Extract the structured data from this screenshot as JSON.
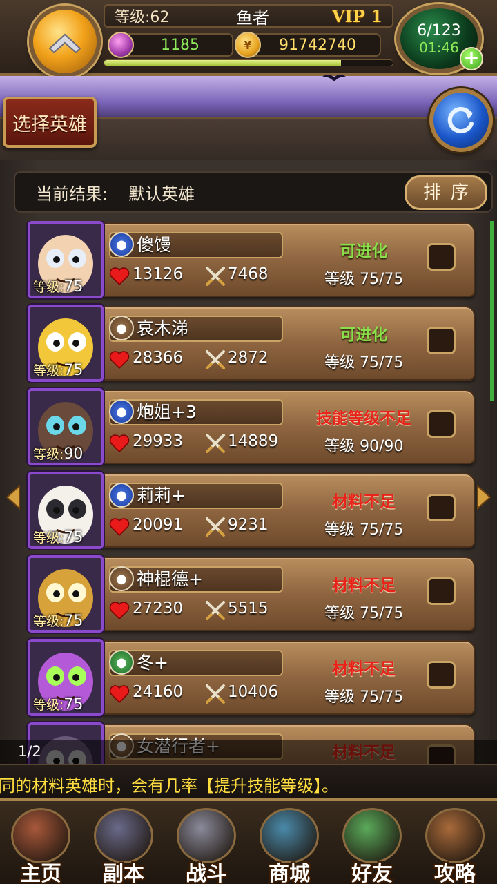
{
  "top_bar": {
    "level_label": "等级:62",
    "player_name": "鱼者",
    "vip_label": "VIP 1",
    "gems": "1185",
    "gold": "91742740",
    "exp_fraction": 0.82,
    "stamina": "6/123",
    "stamina_timer": "01:46",
    "plus_label": "+"
  },
  "header": {
    "select_hero_label": "选择英雄"
  },
  "result_bar": {
    "label": "当前结果:",
    "value": "默认英雄",
    "sort_label": "排序"
  },
  "heroes": [
    {
      "name": "傻馒",
      "hp": "13126",
      "atk": "7468",
      "status": "可进化",
      "level": "等级 75/75",
      "portrait_level": "75",
      "type_icon": "skull-icon",
      "type_color": "blue",
      "status_color": "#8ae04a"
    },
    {
      "name": "哀木涕",
      "hp": "28366",
      "atk": "2872",
      "status": "可进化",
      "level": "等级 75/75",
      "portrait_level": "75",
      "type_icon": "wing-icon",
      "type_color": "brown",
      "status_color": "#8ae04a"
    },
    {
      "name": "炮姐+3",
      "hp": "29933",
      "atk": "14889",
      "status": "技能等级不足",
      "level": "等级 90/90",
      "portrait_level": "90",
      "type_icon": "skull-icon",
      "type_color": "blue",
      "status_color": "#e8241a"
    },
    {
      "name": "莉莉+",
      "hp": "20091",
      "atk": "9231",
      "status": "材料不足",
      "level": "等级 75/75",
      "portrait_level": "75",
      "type_icon": "skull-icon",
      "type_color": "blue",
      "status_color": "#e8241a"
    },
    {
      "name": "神棍德+",
      "hp": "27230",
      "atk": "5515",
      "status": "材料不足",
      "level": "等级 75/75",
      "portrait_level": "75",
      "type_icon": "paw-icon",
      "type_color": "brown",
      "status_color": "#e8241a"
    },
    {
      "name": "冬+",
      "hp": "24160",
      "atk": "10406",
      "status": "材料不足",
      "level": "等级 75/75",
      "portrait_level": "75",
      "type_icon": "bow-icon",
      "type_color": "green",
      "status_color": "#e8241a"
    },
    {
      "name": "女潜行者+",
      "hp": "",
      "atk": "",
      "status": "材料不足",
      "level": "",
      "portrait_level": "",
      "type_icon": "bow-icon",
      "type_color": "brown",
      "status_color": "#e8241a"
    }
  ],
  "portrait_level_prefix": "等级:",
  "page_indicator": "1/2",
  "tip": "同的材料英雄时，会有几率【提升技能等级】。",
  "bottom_nav": [
    {
      "label": "主页",
      "icon": "house-icon"
    },
    {
      "label": "副本",
      "icon": "skull-portal-icon"
    },
    {
      "label": "战斗",
      "icon": "swords-icon"
    },
    {
      "label": "商城",
      "icon": "shop-monster-icon"
    },
    {
      "label": "好友",
      "icon": "friends-icon"
    },
    {
      "label": "攻略",
      "icon": "guide-book-icon"
    }
  ],
  "colors": {
    "green_status": "#8ae04a",
    "red_status": "#e8241a",
    "gold_text": "#ffdf6a",
    "gem_text": "#8fea5a",
    "tip_text": "#ffdd40"
  }
}
